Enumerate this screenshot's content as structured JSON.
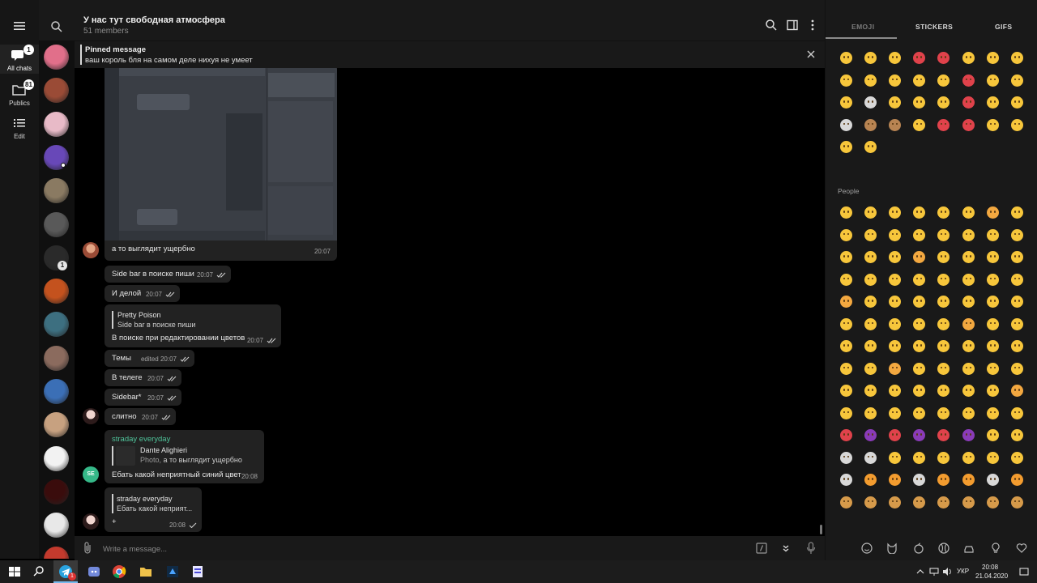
{
  "rail": {
    "items": [
      {
        "label": "",
        "icon": "menu-icon"
      },
      {
        "label": "All chats",
        "icon": "chats-icon",
        "badge": "1"
      },
      {
        "label": "Publics",
        "icon": "folder-icon",
        "badge": "81"
      },
      {
        "label": "Edit",
        "icon": "list-icon"
      }
    ]
  },
  "chat_list": {
    "avatar_colors": [
      "#e16f8a",
      "#9a4b36",
      "#e8bac7",
      "#6848b8",
      "#8a7a62",
      "#595959",
      "#2a2a2a",
      "#c4521e",
      "#3d6f80",
      "#8b6b5e",
      "#3b6fb6",
      "#c7a180",
      "#f2f2f2",
      "#3a0c0c",
      "#e8e8e8",
      "#c43a2d"
    ],
    "badges": {
      "6": "1"
    }
  },
  "header": {
    "title": "У нас тут свободная атмосфера",
    "members": "51 members"
  },
  "pinned": {
    "label": "Pinned message",
    "text": "ваш король бля на самом деле нихуя не умеет"
  },
  "messages": [
    {
      "text": "а то выглядит ущербно",
      "time": "20:07"
    },
    {
      "text": "Side bar в поиске пиши",
      "time": "20:07"
    },
    {
      "text": "И делой",
      "time": "20:07"
    },
    {
      "reply_author": "Pretty Poison",
      "reply_text": "Side bar в поиске пиши",
      "text": "В поиске при редактировании цветов",
      "time": "20:07"
    },
    {
      "text": "Темы",
      "time": "edited 20:07"
    },
    {
      "text": "В телеге",
      "time": "20:07"
    },
    {
      "text": "Sidebar*",
      "time": "20:07"
    },
    {
      "text": "слитно",
      "time": "20:07"
    },
    {
      "author": "straday everyday",
      "reply_author": "Dante Alighieri",
      "reply_prefix": "Photo,",
      "reply_text": " а то выглядит ущербно",
      "text": "Ебать какой неприятный синий цвет",
      "time": "20:08",
      "avatar_initials": "SE"
    },
    {
      "reply_author": "straday everyday",
      "reply_text": "Ебать какой неприят...",
      "text": "+",
      "time": "20:08"
    }
  ],
  "composer": {
    "placeholder": "Write a message..."
  },
  "emoji_panel": {
    "tabs": [
      "EMOJI",
      "STICKERS",
      "GIFS"
    ],
    "people_label": "People",
    "accent": "#f7c63b",
    "recent_count": 34,
    "people_count": 112
  },
  "taskbar": {
    "lang": "УКР",
    "time": "20:08",
    "date": "21.04.2020",
    "telegram_badge": "1"
  }
}
